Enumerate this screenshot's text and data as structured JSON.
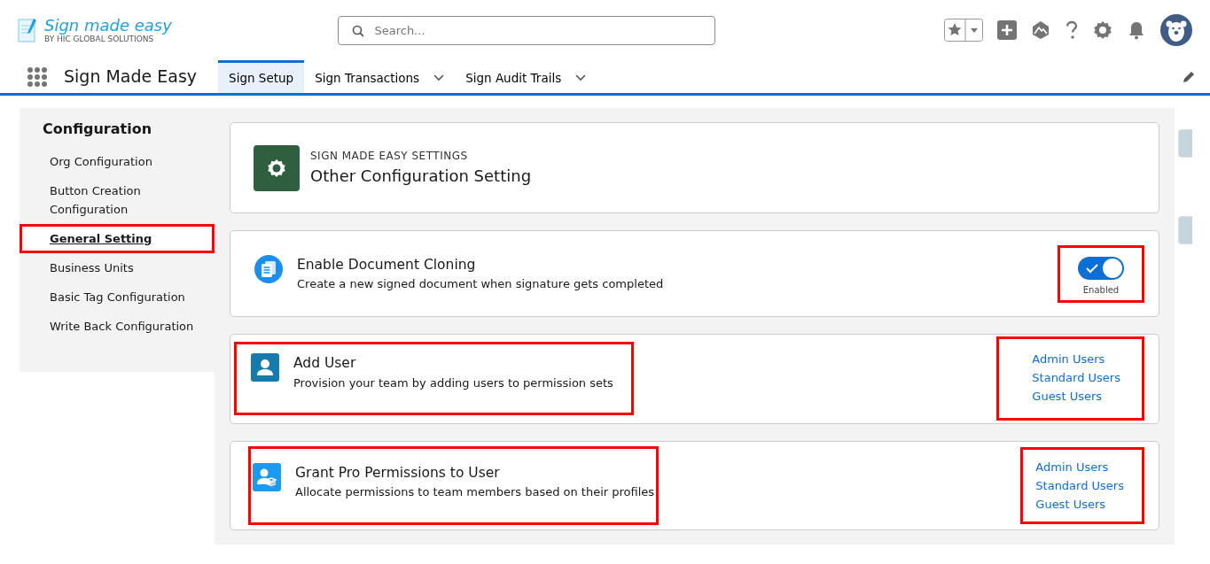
{
  "app": {
    "logo_title": "Sign made easy",
    "logo_subtitle": "BY HIC GLOBAL SOLUTIONS",
    "name": "Sign Made Easy"
  },
  "search": {
    "placeholder": "Search..."
  },
  "nav_tabs": [
    {
      "label": "Sign Setup",
      "selected": true,
      "has_menu": false
    },
    {
      "label": "Sign Transactions",
      "selected": false,
      "has_menu": true
    },
    {
      "label": "Sign Audit Trails",
      "selected": false,
      "has_menu": true
    }
  ],
  "sidebar": {
    "title": "Configuration",
    "items": [
      {
        "label": "Org Configuration",
        "selected": false,
        "highlighted": false
      },
      {
        "label": "Button Creation Configuration",
        "selected": false,
        "highlighted": false
      },
      {
        "label": "General Setting",
        "selected": true,
        "highlighted": true
      },
      {
        "label": "Business Units",
        "selected": false,
        "highlighted": false
      },
      {
        "label": "Basic Tag Configuration",
        "selected": false,
        "highlighted": false
      },
      {
        "label": "Write Back Configuration",
        "selected": false,
        "highlighted": false
      }
    ]
  },
  "header_card": {
    "eyebrow": "SIGN MADE EASY SETTINGS",
    "title": "Other Configuration Setting"
  },
  "settings": [
    {
      "kind": "toggle",
      "title": "Enable Document Cloning",
      "description": "Create a new signed document when signature gets completed",
      "on": true,
      "toggle_label": "Enabled",
      "text_highlighted": false,
      "control_highlighted": true
    },
    {
      "kind": "links",
      "title": "Add User",
      "description": "Provision your team by adding users to permission sets",
      "links": [
        "Admin Users",
        "Standard Users",
        "Guest Users"
      ],
      "text_highlighted": true,
      "control_highlighted": true
    },
    {
      "kind": "links",
      "title": "Grant Pro Permissions to User",
      "description": "Allocate permissions to team members based on their profiles",
      "links": [
        "Admin Users",
        "Standard Users",
        "Guest Users"
      ],
      "text_highlighted": true,
      "control_highlighted": true
    }
  ]
}
